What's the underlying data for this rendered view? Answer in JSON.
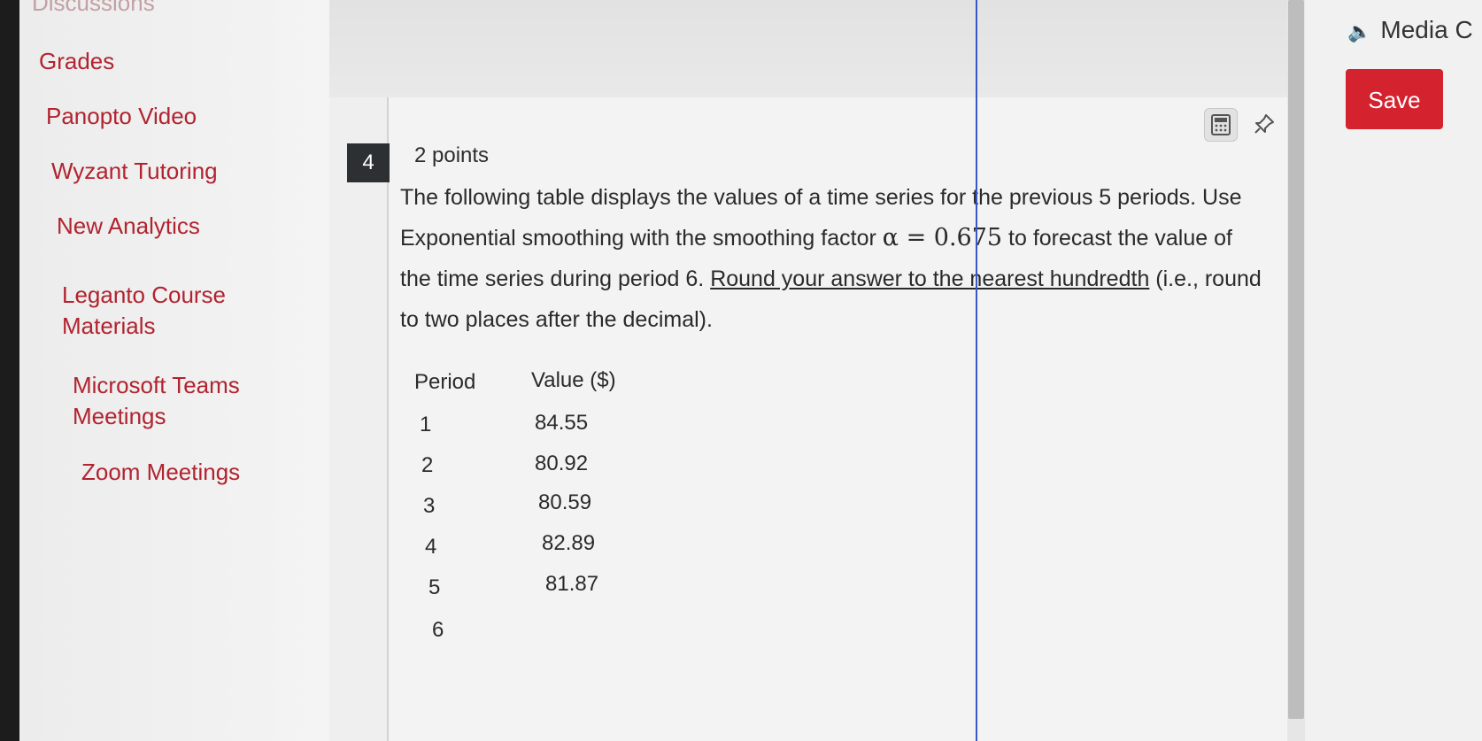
{
  "sidebar": {
    "items": [
      {
        "label": "Discussions"
      },
      {
        "label": "Grades"
      },
      {
        "label": "Panopto Video"
      },
      {
        "label": "Wyzant Tutoring"
      },
      {
        "label": "New Analytics"
      },
      {
        "label": "Leganto Course Materials"
      },
      {
        "label": "Microsoft Teams Meetings"
      },
      {
        "label": "Zoom Meetings"
      }
    ]
  },
  "question": {
    "number": "4",
    "points": "2 points",
    "prompt": {
      "part1": "The following table displays the values of a time series for the previous 5 periods. Use Exponential smoothing with the smoothing factor ",
      "math": "α = 0.675",
      "part2": " to forecast the value of the time series during period 6. ",
      "underlined": "Round your answer to the nearest hundredth",
      "part3": " (i.e., round to two places after the decimal)."
    },
    "tools": {
      "calculator_icon": "calculator-icon",
      "pin_icon": "pin-icon"
    },
    "table": {
      "headers": [
        "Period",
        "Value ($)"
      ],
      "rows": [
        {
          "period": "1",
          "value": "84.55"
        },
        {
          "period": "2",
          "value": "80.92"
        },
        {
          "period": "3",
          "value": "80.59"
        },
        {
          "period": "4",
          "value": "82.89"
        },
        {
          "period": "5",
          "value": "81.87"
        },
        {
          "period": "6",
          "value": ""
        }
      ]
    }
  },
  "right_panel": {
    "media_label": "Media C",
    "save_label": "Save"
  },
  "colors": {
    "nav_link": "#b1232f",
    "save_button": "#d4222e",
    "question_badge": "#2d3033",
    "cursor_line": "#3a55c8"
  }
}
